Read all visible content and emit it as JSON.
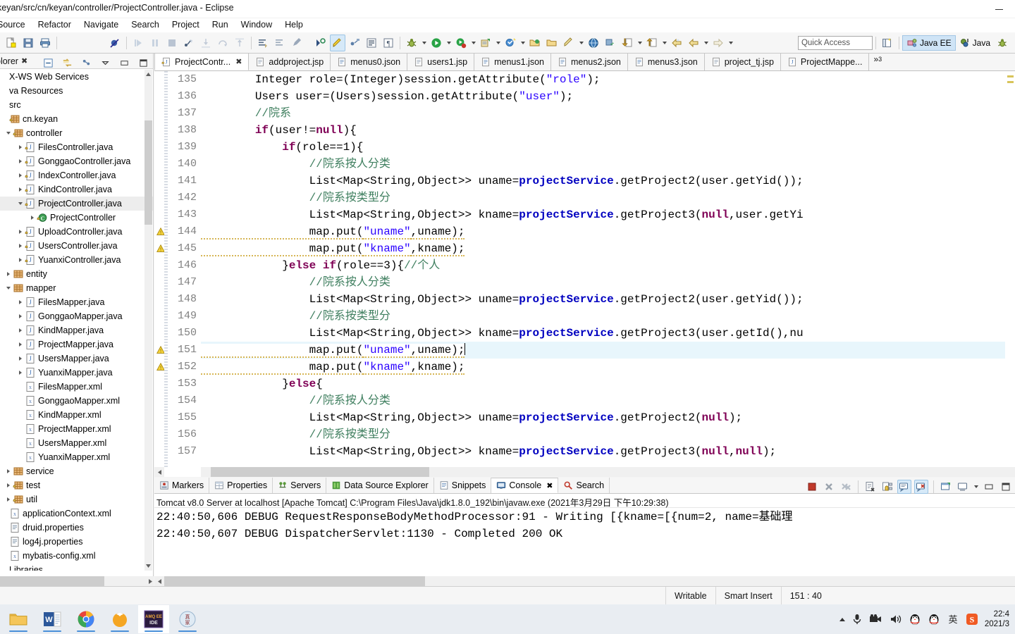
{
  "window": {
    "title": "keyan/src/cn/keyan/controller/ProjectController.java - Eclipse",
    "minimize_label": "—"
  },
  "menu": {
    "items": [
      "Source",
      "Refactor",
      "Navigate",
      "Search",
      "Project",
      "Run",
      "Window",
      "Help"
    ]
  },
  "toolbar": {
    "quick_access_placeholder": "Quick Access",
    "perspective_java_ee": "Java EE",
    "perspective_java": "Java"
  },
  "sidebar": {
    "view_tab": "plorer",
    "tree": [
      {
        "label": "X-WS Web Services",
        "indent": 0,
        "arrow": "none",
        "icon": "none"
      },
      {
        "label": "va Resources",
        "indent": 0,
        "arrow": "none",
        "icon": "none"
      },
      {
        "label": "src",
        "indent": 0,
        "arrow": "none",
        "icon": "none"
      },
      {
        "label": "cn.keyan",
        "indent": 0,
        "arrow": "none",
        "icon": "package-lock"
      },
      {
        "label": "controller",
        "indent": 1,
        "arrow": "down",
        "icon": "package-lock"
      },
      {
        "label": "FilesController.java",
        "indent": 2,
        "arrow": "right",
        "icon": "java-lock"
      },
      {
        "label": "GonggaoController.java",
        "indent": 2,
        "arrow": "right",
        "icon": "java-lock"
      },
      {
        "label": "IndexController.java",
        "indent": 2,
        "arrow": "right",
        "icon": "java-lock"
      },
      {
        "label": "KindController.java",
        "indent": 2,
        "arrow": "right",
        "icon": "java-lock"
      },
      {
        "label": "ProjectController.java",
        "indent": 2,
        "arrow": "down",
        "icon": "java-lock",
        "selected": true
      },
      {
        "label": "ProjectController",
        "indent": 3,
        "arrow": "right",
        "icon": "class-lock"
      },
      {
        "label": "UploadController.java",
        "indent": 2,
        "arrow": "right",
        "icon": "java-lock"
      },
      {
        "label": "UsersController.java",
        "indent": 2,
        "arrow": "right",
        "icon": "java-lock"
      },
      {
        "label": "YuanxiController.java",
        "indent": 2,
        "arrow": "right",
        "icon": "java-lock"
      },
      {
        "label": "entity",
        "indent": 1,
        "arrow": "right",
        "icon": "package"
      },
      {
        "label": "mapper",
        "indent": 1,
        "arrow": "down",
        "icon": "package"
      },
      {
        "label": "FilesMapper.java",
        "indent": 2,
        "arrow": "right",
        "icon": "java"
      },
      {
        "label": "GonggaoMapper.java",
        "indent": 2,
        "arrow": "right",
        "icon": "java"
      },
      {
        "label": "KindMapper.java",
        "indent": 2,
        "arrow": "right",
        "icon": "java"
      },
      {
        "label": "ProjectMapper.java",
        "indent": 2,
        "arrow": "right",
        "icon": "java"
      },
      {
        "label": "UsersMapper.java",
        "indent": 2,
        "arrow": "right",
        "icon": "java"
      },
      {
        "label": "YuanxiMapper.java",
        "indent": 2,
        "arrow": "right",
        "icon": "java"
      },
      {
        "label": "FilesMapper.xml",
        "indent": 2,
        "arrow": "none",
        "icon": "xml"
      },
      {
        "label": "GonggaoMapper.xml",
        "indent": 2,
        "arrow": "none",
        "icon": "xml"
      },
      {
        "label": "KindMapper.xml",
        "indent": 2,
        "arrow": "none",
        "icon": "xml"
      },
      {
        "label": "ProjectMapper.xml",
        "indent": 2,
        "arrow": "none",
        "icon": "xml"
      },
      {
        "label": "UsersMapper.xml",
        "indent": 2,
        "arrow": "none",
        "icon": "xml"
      },
      {
        "label": "YuanxiMapper.xml",
        "indent": 2,
        "arrow": "none",
        "icon": "xml"
      },
      {
        "label": "service",
        "indent": 1,
        "arrow": "right",
        "icon": "package"
      },
      {
        "label": "test",
        "indent": 1,
        "arrow": "right",
        "icon": "package-lock"
      },
      {
        "label": "util",
        "indent": 1,
        "arrow": "right",
        "icon": "package-lock"
      },
      {
        "label": "applicationContext.xml",
        "indent": 0,
        "arrow": "none",
        "icon": "xml"
      },
      {
        "label": "druid.properties",
        "indent": 0,
        "arrow": "none",
        "icon": "props"
      },
      {
        "label": "log4j.properties",
        "indent": 0,
        "arrow": "none",
        "icon": "props"
      },
      {
        "label": "mybatis-config.xml",
        "indent": 0,
        "arrow": "none",
        "icon": "xml"
      },
      {
        "label": "Libraries",
        "indent": 0,
        "arrow": "none",
        "icon": "none"
      }
    ]
  },
  "editor": {
    "tabs": [
      {
        "label": "ProjectContr...",
        "icon": "java-lock",
        "active": true,
        "closable": true
      },
      {
        "label": "addproject.jsp",
        "icon": "jsp",
        "active": false
      },
      {
        "label": "menus0.json",
        "icon": "json",
        "active": false
      },
      {
        "label": "users1.jsp",
        "icon": "jsp",
        "active": false
      },
      {
        "label": "menus1.json",
        "icon": "json",
        "active": false
      },
      {
        "label": "menus2.json",
        "icon": "json",
        "active": false
      },
      {
        "label": "menus3.json",
        "icon": "json",
        "active": false
      },
      {
        "label": "project_tj.jsp",
        "icon": "jsp",
        "active": false
      },
      {
        "label": "ProjectMappe...",
        "icon": "java",
        "active": false
      }
    ],
    "overflow_label": "»",
    "overflow_count": "3",
    "first_line_number": 135,
    "current_line": 151,
    "lines": [
      {
        "n": 135,
        "tokens": [
          {
            "t": "        ",
            "c": "pln"
          },
          {
            "t": "Integer",
            "c": "pln"
          },
          {
            "t": " role=(",
            "c": "pln"
          },
          {
            "t": "Integer",
            "c": "pln"
          },
          {
            "t": ")session.getAttribute(",
            "c": "pln"
          },
          {
            "t": "\"role\"",
            "c": "str"
          },
          {
            "t": ");",
            "c": "pln"
          }
        ]
      },
      {
        "n": 136,
        "tokens": [
          {
            "t": "        Users user=(Users)session.getAttribute(",
            "c": "pln"
          },
          {
            "t": "\"user\"",
            "c": "str"
          },
          {
            "t": ");",
            "c": "pln"
          }
        ]
      },
      {
        "n": 137,
        "tokens": [
          {
            "t": "        //院系",
            "c": "cmt"
          }
        ]
      },
      {
        "n": 138,
        "tokens": [
          {
            "t": "        ",
            "c": "pln"
          },
          {
            "t": "if",
            "c": "kw"
          },
          {
            "t": "(user!=",
            "c": "pln"
          },
          {
            "t": "null",
            "c": "kw"
          },
          {
            "t": "){",
            "c": "pln"
          }
        ]
      },
      {
        "n": 139,
        "tokens": [
          {
            "t": "            ",
            "c": "pln"
          },
          {
            "t": "if",
            "c": "kw"
          },
          {
            "t": "(role==1){",
            "c": "pln"
          }
        ]
      },
      {
        "n": 140,
        "tokens": [
          {
            "t": "                //院系按人分类",
            "c": "cmt"
          }
        ]
      },
      {
        "n": 141,
        "tokens": [
          {
            "t": "                List<Map<String,Object>> uname=",
            "c": "pln"
          },
          {
            "t": "projectService",
            "c": "fld"
          },
          {
            "t": ".getProject2(user.getYid());",
            "c": "pln"
          }
        ]
      },
      {
        "n": 142,
        "tokens": [
          {
            "t": "                //院系按类型分",
            "c": "cmt"
          }
        ]
      },
      {
        "n": 143,
        "tokens": [
          {
            "t": "                List<Map<String,Object>> kname=",
            "c": "pln"
          },
          {
            "t": "projectService",
            "c": "fld"
          },
          {
            "t": ".getProject3(",
            "c": "pln"
          },
          {
            "t": "null",
            "c": "kw"
          },
          {
            "t": ",user.getYi",
            "c": "pln"
          }
        ]
      },
      {
        "n": 144,
        "warn": true,
        "tokens": [
          {
            "t": "                map.put(",
            "c": "pln"
          },
          {
            "t": "\"uname\"",
            "c": "str"
          },
          {
            "t": ",uname);",
            "c": "pln"
          }
        ]
      },
      {
        "n": 145,
        "warn": true,
        "tokens": [
          {
            "t": "                map.put(",
            "c": "pln"
          },
          {
            "t": "\"kname\"",
            "c": "str"
          },
          {
            "t": ",kname);",
            "c": "pln"
          }
        ]
      },
      {
        "n": 146,
        "tokens": [
          {
            "t": "            }",
            "c": "pln"
          },
          {
            "t": "else",
            "c": "kw"
          },
          {
            "t": " ",
            "c": "pln"
          },
          {
            "t": "if",
            "c": "kw"
          },
          {
            "t": "(role==3){",
            "c": "pln"
          },
          {
            "t": "//个人",
            "c": "cmt"
          }
        ]
      },
      {
        "n": 147,
        "tokens": [
          {
            "t": "                //院系按人分类",
            "c": "cmt"
          }
        ]
      },
      {
        "n": 148,
        "tokens": [
          {
            "t": "                List<Map<String,Object>> uname=",
            "c": "pln"
          },
          {
            "t": "projectService",
            "c": "fld"
          },
          {
            "t": ".getProject2(user.getYid());",
            "c": "pln"
          }
        ]
      },
      {
        "n": 149,
        "tokens": [
          {
            "t": "                //院系按类型分",
            "c": "cmt"
          }
        ]
      },
      {
        "n": 150,
        "tokens": [
          {
            "t": "                List<Map<String,Object>> kname=",
            "c": "pln"
          },
          {
            "t": "projectService",
            "c": "fld"
          },
          {
            "t": ".getProject3(user.getId(),nu",
            "c": "pln"
          }
        ]
      },
      {
        "n": 151,
        "warn": true,
        "current": true,
        "tokens": [
          {
            "t": "                map.put(",
            "c": "pln"
          },
          {
            "t": "\"uname\"",
            "c": "str"
          },
          {
            "t": ",uname);",
            "c": "pln"
          }
        ]
      },
      {
        "n": 152,
        "warn": true,
        "tokens": [
          {
            "t": "                map.put(",
            "c": "pln"
          },
          {
            "t": "\"kname\"",
            "c": "str"
          },
          {
            "t": ",kname);",
            "c": "pln"
          }
        ]
      },
      {
        "n": 153,
        "tokens": [
          {
            "t": "            }",
            "c": "pln"
          },
          {
            "t": "else",
            "c": "kw"
          },
          {
            "t": "{",
            "c": "pln"
          }
        ]
      },
      {
        "n": 154,
        "tokens": [
          {
            "t": "                //院系按人分类",
            "c": "cmt"
          }
        ]
      },
      {
        "n": 155,
        "tokens": [
          {
            "t": "                List<Map<String,Object>> uname=",
            "c": "pln"
          },
          {
            "t": "projectService",
            "c": "fld"
          },
          {
            "t": ".getProject2(",
            "c": "pln"
          },
          {
            "t": "null",
            "c": "kw"
          },
          {
            "t": ");",
            "c": "pln"
          }
        ]
      },
      {
        "n": 156,
        "tokens": [
          {
            "t": "                //院系按类型分",
            "c": "cmt"
          }
        ]
      },
      {
        "n": 157,
        "tokens": [
          {
            "t": "                List<Map<String,Object>> kname=",
            "c": "pln"
          },
          {
            "t": "projectService",
            "c": "fld"
          },
          {
            "t": ".getProject3(",
            "c": "pln"
          },
          {
            "t": "null",
            "c": "kw"
          },
          {
            "t": ",",
            "c": "pln"
          },
          {
            "t": "null",
            "c": "kw"
          },
          {
            "t": ");",
            "c": "pln"
          }
        ]
      }
    ]
  },
  "bottom_panel": {
    "tabs": [
      {
        "label": "Markers",
        "icon": "markers",
        "active": false
      },
      {
        "label": "Properties",
        "icon": "properties",
        "active": false
      },
      {
        "label": "Servers",
        "icon": "servers",
        "active": false
      },
      {
        "label": "Data Source Explorer",
        "icon": "datasource",
        "active": false
      },
      {
        "label": "Snippets",
        "icon": "snippets",
        "active": false
      },
      {
        "label": "Console",
        "icon": "console",
        "active": true,
        "closable": true
      },
      {
        "label": "Search",
        "icon": "search",
        "active": false
      }
    ],
    "console_header": "Tomcat v8.0 Server at localhost [Apache Tomcat] C:\\Program Files\\Java\\jdk1.8.0_192\\bin\\javaw.exe (2021年3月29日 下午10:29:38)",
    "console_lines": [
      "22:40:50,606 DEBUG RequestResponseBodyMethodProcessor:91 - Writing [{kname=[{num=2, name=基础理",
      "22:40:50,607 DEBUG DispatcherServlet:1130 - Completed 200 OK"
    ]
  },
  "statusbar": {
    "writable": "Writable",
    "insert_mode": "Smart Insert",
    "position": "151 : 40"
  },
  "taskbar": {
    "apps": [
      {
        "name": "file-explorer-icon",
        "active": false
      },
      {
        "name": "word-icon",
        "active": false
      },
      {
        "name": "chrome-icon",
        "active": false
      },
      {
        "name": "orange-app-icon",
        "active": false
      },
      {
        "name": "eclipse-icon",
        "active": true
      },
      {
        "name": "sogou-app-icon",
        "active": false
      }
    ],
    "tray_time": "22:4",
    "tray_date": "2021/3"
  },
  "colors": {
    "keyword": "#7f0055",
    "string": "#2a00ff",
    "comment": "#3f7f5f",
    "field": "#0000c0",
    "current_line": "#e8f6fc",
    "accent": "#4a90d9"
  }
}
